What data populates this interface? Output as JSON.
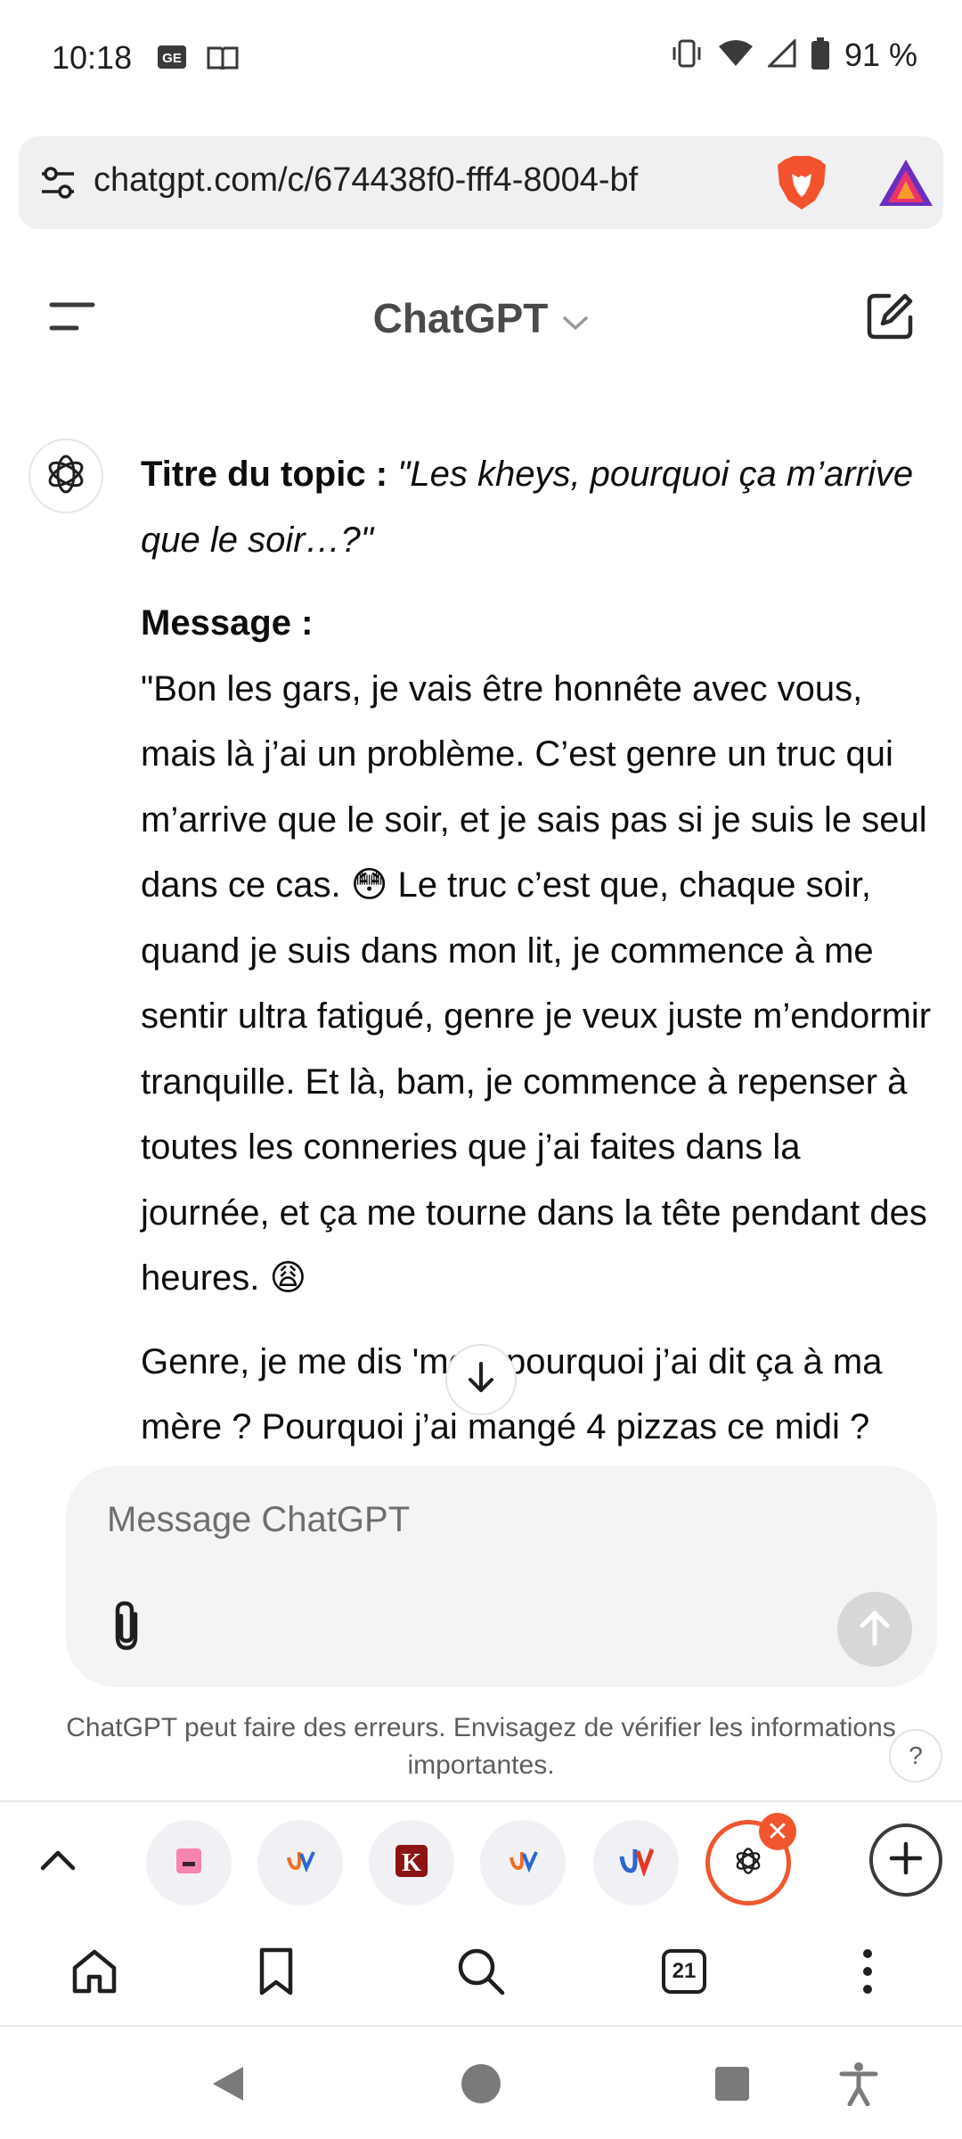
{
  "status_bar": {
    "time": "10:18",
    "battery_percent": "91 %",
    "left_icons": [
      "sim-card-icon",
      "reader-icon"
    ],
    "right_icons": [
      "vibrate-icon",
      "wifi-icon",
      "signal-icon",
      "battery-icon"
    ]
  },
  "browser": {
    "url": "chatgpt.com/c/674438f0-fff4-8004-bf",
    "icons": [
      "site-settings-icon",
      "brave-shields-icon",
      "brave-rewards-icon"
    ]
  },
  "app": {
    "title": "ChatGPT"
  },
  "message": {
    "topic_label": "Titre du topic :",
    "topic_title": "\"Les kheys, pourquoi ça m’arrive que le soir…?\"",
    "message_label": "Message :",
    "paragraph1_a": "\"Bon les gars, je vais être honnête avec vous, mais là j’ai un problème. C’est genre un truc qui m’arrive que le soir, et je sais pas si je suis le seul dans ce cas.",
    "emoji1": "😳",
    "paragraph1_b": "Le truc c’est que, chaque soir, quand je suis dans mon lit, je commence à me sentir ultra fatigué, genre je veux juste m’endormir tranquille. Et là, bam, je commence à repenser à toutes les conneries que j’ai faites dans la journée, et ça me tourne dans la tête pendant des heures.",
    "emoji2": "😩",
    "paragraph2": "Genre, je me dis 'mec, pourquoi j’ai dit ça à ma mère ? Pourquoi j’ai mangé 4 pizzas ce midi ?"
  },
  "composer": {
    "placeholder": "Message ChatGPT",
    "value": ""
  },
  "disclaimer": "ChatGPT peut faire des erreurs. Envisagez de vérifier les informations importantes.",
  "help_label": "?",
  "tabs": {
    "count": "21",
    "items": [
      {
        "icon": "pink-tab-icon"
      },
      {
        "icon": "jv-tab-icon"
      },
      {
        "icon": "k-tab-icon"
      },
      {
        "icon": "jv-tab-icon"
      },
      {
        "icon": "jv-tab-icon"
      },
      {
        "icon": "chatgpt-tab-icon",
        "active": true
      }
    ]
  },
  "colors": {
    "accent": "#f0552f",
    "text": "#0d0d0d",
    "composer_bg": "#f4f4f4",
    "url_bg": "#f0f0f3"
  }
}
